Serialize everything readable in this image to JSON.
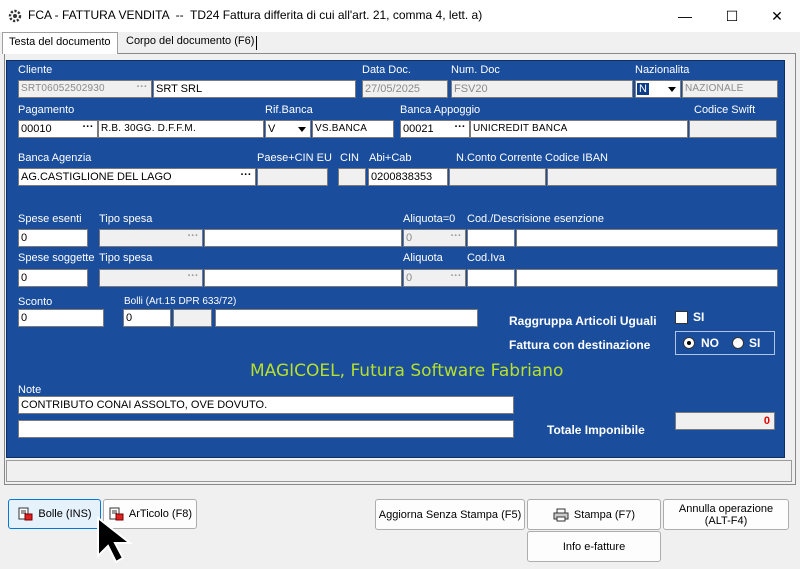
{
  "window": {
    "title": "FCA - FATTURA VENDITA  --  TD24 Fattura differita di cui all'art. 21, comma 4, lett. a)",
    "minimize": "—",
    "maximize": "☐",
    "close": "✕"
  },
  "tabs": [
    {
      "label": "Testa del documento",
      "active": true
    },
    {
      "label": "Corpo del documento (F6)",
      "active": false
    }
  ],
  "labels": {
    "cliente": "Cliente",
    "data_doc": "Data Doc.",
    "num_doc": "Num. Doc",
    "nazionalita": "Nazionalita",
    "pagamento": "Pagamento",
    "rif_banca": "Rif.Banca",
    "banca_appoggio": "Banca Appoggio",
    "codice_swift": "Codice Swift",
    "banca_agenzia": "Banca Agenzia",
    "paese_cin_eu": "Paese+CIN EU",
    "cin": "CIN",
    "abi_cab": "Abi+Cab",
    "nconto": "N.Conto Corrente",
    "iban": "Codice IBAN",
    "spese_esenti": "Spese esenti",
    "tipo_spesa_1": "Tipo spesa",
    "aliquota_0": "Aliquota=0",
    "cod_desc_esenzione": "Cod./Descrisione esenzione",
    "spese_soggette": "Spese soggette",
    "tipo_spesa_2": "Tipo spesa",
    "aliquota": "Aliquota",
    "cod_iva": "Cod.Iva",
    "sconto": "Sconto",
    "bolli": "Bolli (Art.15 DPR 633/72)",
    "raggruppa": "Raggruppa Articoli Uguali",
    "si_check": "SI",
    "fattura_dest": "Fattura con destinazione",
    "radio_no": "NO",
    "radio_si": "SI",
    "note": "Note",
    "totale_imponibile": "Totale Imponibile"
  },
  "fields": {
    "cliente_code": "SRT06052502930",
    "cliente_name": "SRT SRL",
    "data_doc": "27/05/2025",
    "num_doc": "FSV20",
    "nazionalita_code": "N",
    "nazionalita_desc": "NAZIONALE",
    "pagamento_code": "00010",
    "pagamento_desc": "R.B. 30GG. D.F.F.M.",
    "rif_banca_code": "V",
    "rif_banca_desc": "VS.BANCA",
    "banca_appoggio_code": "00021",
    "banca_appoggio_desc": "UNICREDIT BANCA",
    "codice_swift": "",
    "banca_agenzia": "AG.CASTIGLIONE DEL LAGO",
    "paese_cin_eu": "",
    "cin": "",
    "abi_cab": "0200838353",
    "nconto": "",
    "iban": "",
    "spese_esenti": "0",
    "aliquota_0": "0",
    "spese_soggette": "0",
    "aliquota": "0",
    "sconto": "0",
    "bolli": "0",
    "note_1": "CONTRIBUTO CONAI ASSOLTO, OVE DOVUTO.",
    "note_2": "",
    "totale_imponibile": "0",
    "dots": "···"
  },
  "brand": "MAGICOEL, Futura Software Fabriano",
  "buttons": {
    "bolle": "Bolle  (INS)",
    "articolo": "ArTicolo (F8)",
    "aggiorna": "Aggiorna Senza Stampa (F5)",
    "stampa": "Stampa  (F7)",
    "annulla_1": "Annulla operazione",
    "annulla_2": "(ALT-F4)",
    "info": "Info e-fatture"
  },
  "colors": {
    "panel_blue": "#1a4d9c",
    "brand_green": "#b6e02b",
    "total_red": "#e00000"
  }
}
